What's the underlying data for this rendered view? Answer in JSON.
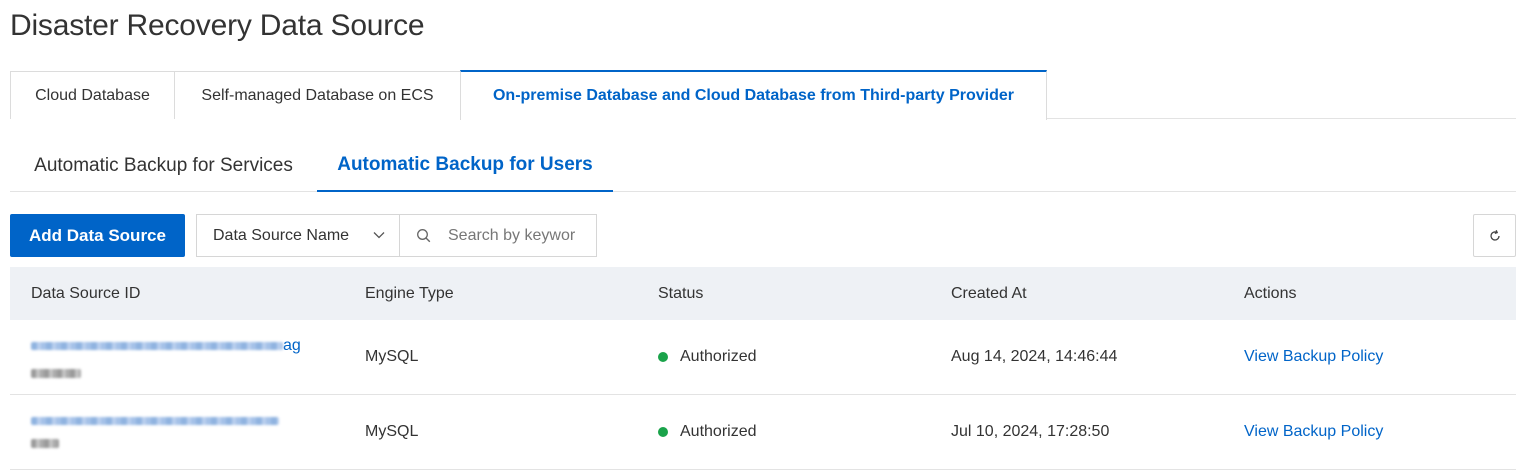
{
  "page": {
    "title": "Disaster Recovery Data Source"
  },
  "card_tabs": [
    {
      "label": "Cloud Database",
      "active": false
    },
    {
      "label": "Self-managed Database on ECS",
      "active": false
    },
    {
      "label": "On-premise Database and Cloud Database from Third-party Provider",
      "active": true
    }
  ],
  "sub_tabs": [
    {
      "label": "Automatic Backup for Services",
      "active": false
    },
    {
      "label": "Automatic Backup for Users",
      "active": true
    }
  ],
  "toolbar": {
    "add_label": "Add Data Source",
    "filter_selected": "Data Source Name",
    "search_placeholder": "Search by keywor"
  },
  "table": {
    "headers": [
      "Data Source ID",
      "Engine Type",
      "Status",
      "Created At",
      "Actions"
    ],
    "rows": [
      {
        "id_suffix": "ag",
        "engine": "MySQL",
        "status": "Authorized",
        "created": "Aug 14, 2024, 14:46:44",
        "action": "View Backup Policy"
      },
      {
        "id_suffix": "",
        "engine": "MySQL",
        "status": "Authorized",
        "created": "Jul 10, 2024, 17:28:50",
        "action": "View Backup Policy"
      }
    ]
  },
  "colors": {
    "accent": "#0064c8",
    "status_ok": "#1aa34a",
    "header_bg": "#eef1f5"
  },
  "icons": {
    "filter_chevron": "chevron-down-icon",
    "search": "search-icon",
    "refresh": "refresh-icon"
  }
}
